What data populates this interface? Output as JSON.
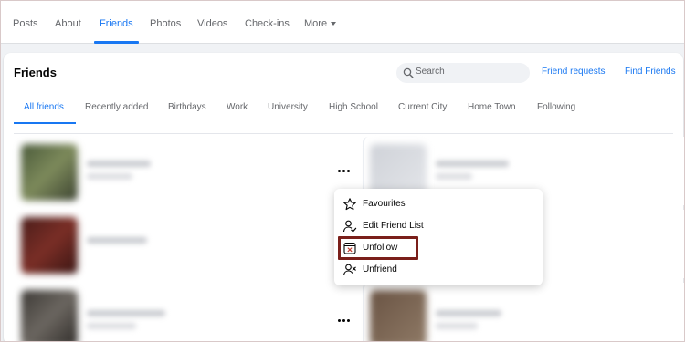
{
  "profile_tabs": [
    {
      "label": "Posts",
      "active": false
    },
    {
      "label": "About",
      "active": false
    },
    {
      "label": "Friends",
      "active": true
    },
    {
      "label": "Photos",
      "active": false
    },
    {
      "label": "Videos",
      "active": false
    },
    {
      "label": "Check-ins",
      "active": false
    },
    {
      "label": "More",
      "active": false
    }
  ],
  "friends_card": {
    "title": "Friends",
    "search_placeholder": "Search",
    "friend_requests_link": "Friend requests",
    "find_friends_link": "Find Friends"
  },
  "friend_tabs": [
    {
      "label": "All friends",
      "active": true
    },
    {
      "label": "Recently added",
      "active": false
    },
    {
      "label": "Birthdays",
      "active": false
    },
    {
      "label": "Work",
      "active": false
    },
    {
      "label": "University",
      "active": false
    },
    {
      "label": "High School",
      "active": false
    },
    {
      "label": "Current City",
      "active": false
    },
    {
      "label": "Home Town",
      "active": false
    },
    {
      "label": "Following",
      "active": false
    }
  ],
  "context_menu": {
    "items": [
      {
        "label": "Favourites",
        "icon": "star-icon"
      },
      {
        "label": "Edit Friend List",
        "icon": "person-edit-icon"
      },
      {
        "label": "Unfollow",
        "icon": "unfollow-icon",
        "highlighted": true
      },
      {
        "label": "Unfriend",
        "icon": "person-remove-icon"
      }
    ]
  },
  "colors": {
    "accent": "#1877f2",
    "highlight_border": "#7a1f1a",
    "page_bg": "#f0f2f5"
  }
}
